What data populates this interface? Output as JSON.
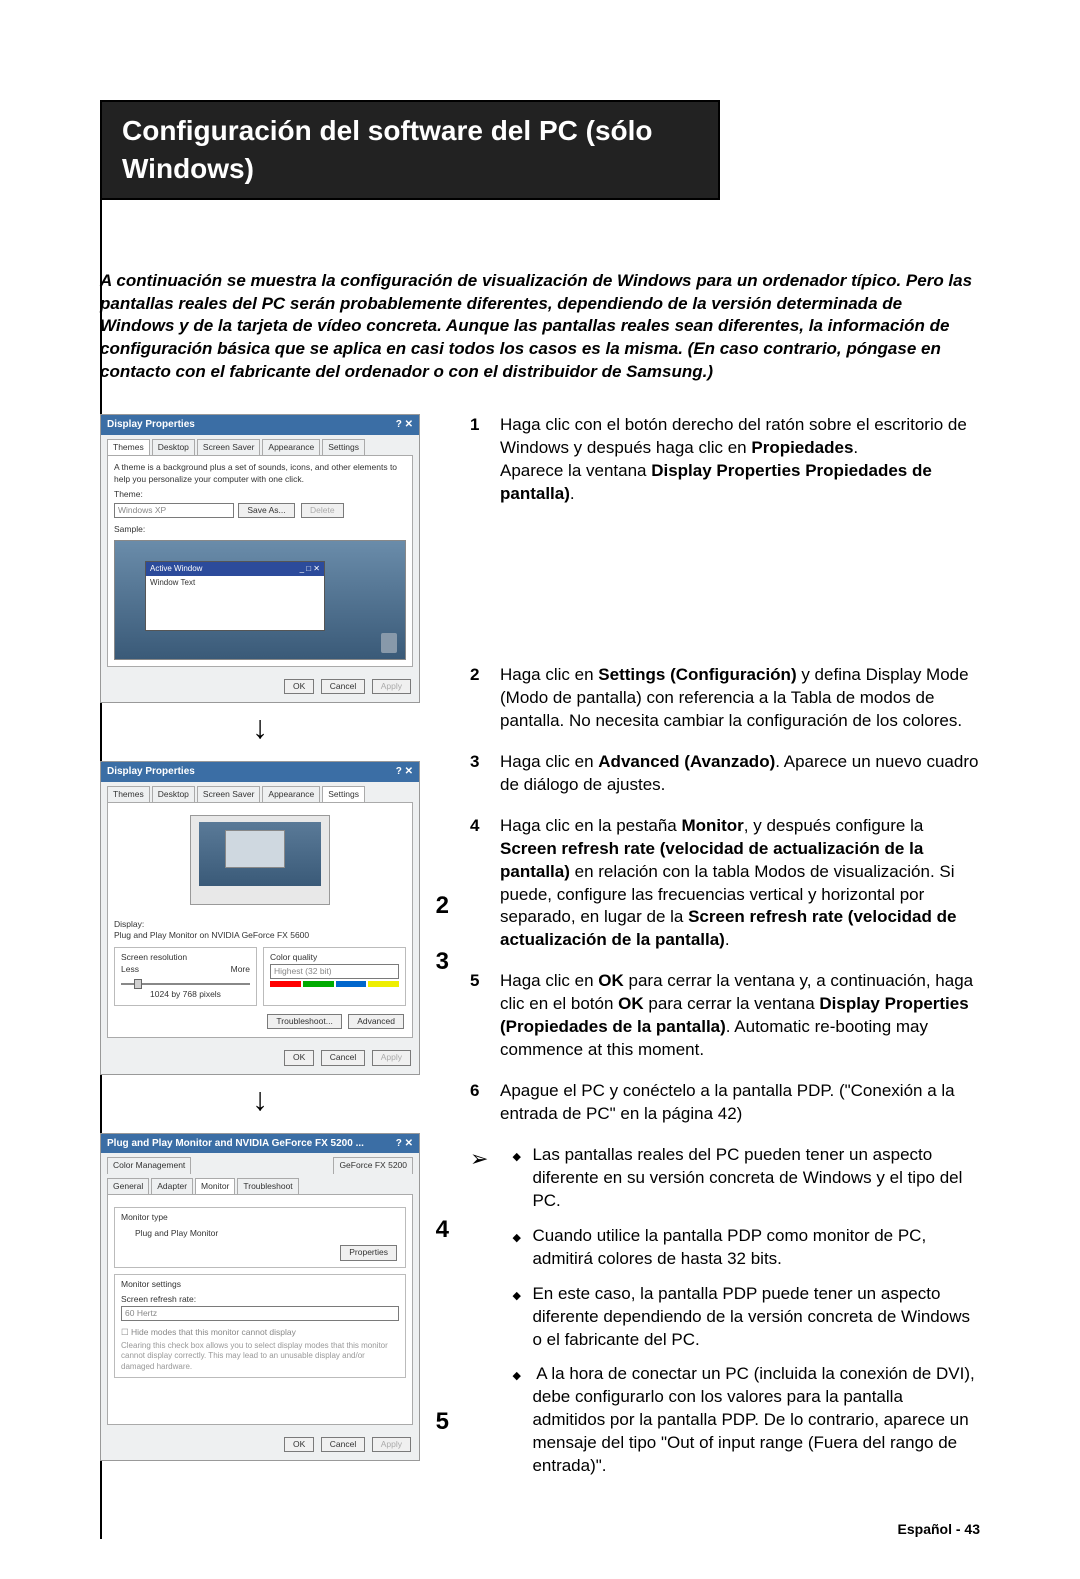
{
  "title": "Configuración del software del PC (sólo Windows)",
  "intro": "A continuación se muestra la configuración de visualización de Windows para un ordenador típico. Pero las pantallas reales del PC serán probablemente diferentes, dependiendo de la versión determinada de Windows y de la tarjeta de vídeo concreta. Aunque las pantallas reales sean diferentes, la información de configuración básica que se aplica en casi todos los casos es la misma. (En caso contrario, póngase en contacto con el fabricante del ordenador o con el distribuidor de Samsung.)",
  "shot1": {
    "title": "Display Properties",
    "tabs": [
      "Themes",
      "Desktop",
      "Screen Saver",
      "Appearance",
      "Settings"
    ],
    "activeTab": 0,
    "desc": "A theme is a background plus a set of sounds, icons, and other elements to help you personalize your computer with one click.",
    "themeLabel": "Theme:",
    "themeValue": "Windows XP",
    "saveAs": "Save As...",
    "delete": "Delete",
    "sampleLabel": "Sample:",
    "activeWin": "Active Window",
    "winText": "Window Text",
    "ok": "OK",
    "cancel": "Cancel",
    "apply": "Apply"
  },
  "shot2": {
    "title": "Display Properties",
    "tabs": [
      "Themes",
      "Desktop",
      "Screen Saver",
      "Appearance",
      "Settings"
    ],
    "activeTab": 4,
    "displayLabel": "Display:",
    "displayValue": "Plug and Play Monitor on NVIDIA GeForce FX 5600",
    "resLegend": "Screen resolution",
    "resLess": "Less",
    "resMore": "More",
    "resValue": "1024 by 768 pixels",
    "cqLegend": "Color quality",
    "cqValue": "Highest (32 bit)",
    "troubleshoot": "Troubleshoot...",
    "advanced": "Advanced",
    "ok": "OK",
    "cancel": "Cancel",
    "apply": "Apply"
  },
  "shot3": {
    "title": "Plug and Play Monitor and NVIDIA GeForce FX 5200 ...",
    "tabsTop": [
      "Color Management",
      "GeForce FX 5200"
    ],
    "tabsBottom": [
      "General",
      "Adapter",
      "Monitor",
      "Troubleshoot"
    ],
    "activeTab": "Monitor",
    "monTypeLegend": "Monitor type",
    "monTypeValue": "Plug and Play Monitor",
    "properties": "Properties",
    "monSetLegend": "Monitor settings",
    "refreshLabel": "Screen refresh rate:",
    "refreshValue": "60 Hertz",
    "hideModes": "Hide modes that this monitor cannot display",
    "hideNote": "Clearing this check box allows you to select display modes that this monitor cannot display correctly. This may lead to an unusable display and/or damaged hardware.",
    "ok": "OK",
    "cancel": "Cancel",
    "apply": "Apply"
  },
  "callouts": {
    "c2": "2",
    "c3": "3",
    "c4": "4",
    "c5": "5"
  },
  "steps": {
    "s1": {
      "n": "1",
      "a": "Haga clic con el botón derecho del ratón sobre el escritorio de Windows y después haga clic en ",
      "b": "Propiedades",
      "c": ".",
      "d": "Aparece la ventana ",
      "e": "Display Properties Propiedades de pantalla)",
      "f": "."
    },
    "s2": {
      "n": "2",
      "a": "Haga clic en ",
      "b": "Settings (Configuración)",
      "c": " y defina Display Mode (Modo de pantalla) con referencia a la Tabla de modos de pantalla. No necesita cambiar la configuración de los colores."
    },
    "s3": {
      "n": "3",
      "a": "Haga clic en ",
      "b": "Advanced (Avanzado)",
      "c": ". Aparece un nuevo cuadro de diálogo de ajustes."
    },
    "s4": {
      "n": "4",
      "a": "Haga clic en la pestaña ",
      "b": "Monitor",
      "c": ", y después configure la ",
      "d": "Screen refresh rate (velocidad de actualización de la pantalla)",
      "e": " en relación con la tabla Modos de visualización. Si puede, configure las frecuencias vertical y horizontal por separado, en lugar de la ",
      "f": "Screen refresh rate (velocidad de actualización de la pantalla)",
      "g": "."
    },
    "s5": {
      "n": "5",
      "a": "Haga clic en ",
      "b": "OK",
      "c": " para cerrar la ventana y, a continuación, haga clic en el botón ",
      "d": "OK",
      "e": " para cerrar la ventana ",
      "f": "Display Properties (Propiedades de la pantalla)",
      "g": ". Automatic re-booting may commence at this moment."
    },
    "s6": {
      "n": "6",
      "a": "Apague el PC y conéctelo a la pantalla PDP. (\"Conexión a la entrada de PC\" en la página 42)"
    }
  },
  "notes": {
    "b1": "Las pantallas reales del PC pueden tener un aspecto diferente en su versión concreta de Windows y el tipo del PC.",
    "b2": "Cuando utilice la pantalla PDP como monitor de PC, admitirá colores de hasta 32 bits.",
    "b3": "En este caso, la pantalla PDP puede tener un aspecto diferente dependiendo de la versión concreta de Windows o el fabricante del PC.",
    "b4a": "A la hora de conectar un PC (incluida la conexión de DVI), debe configurarlo con los valores para la pantalla admitidos por la pantalla PDP. De lo contrario, aparece un mensaje del tipo \"",
    "b4b": "Out of input range (Fuera del rango de entrada)",
    "b4c": "\"."
  },
  "footer": "Español - 43"
}
